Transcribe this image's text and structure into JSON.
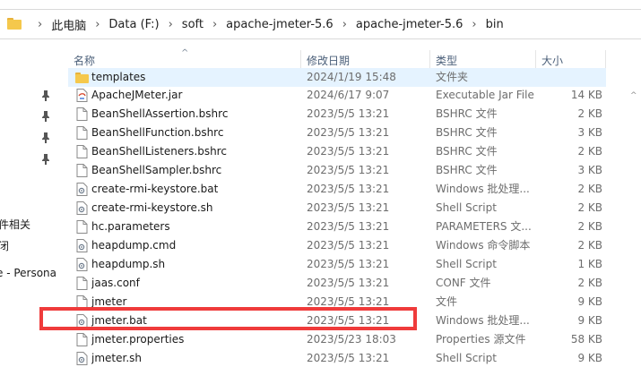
{
  "breadcrumb": [
    "此电脑",
    "Data (F:)",
    "soft",
    "apache-jmeter-5.6",
    "apache-jmeter-5.6",
    "bin"
  ],
  "columns": {
    "name": "名称",
    "modified": "修改日期",
    "type": "类型",
    "size": "大小"
  },
  "nav_labels": [
    "件相关",
    "闭",
    "e - Persona"
  ],
  "files": [
    {
      "name": "templates",
      "modified": "2024/1/19 15:48",
      "type": "文件夹",
      "size": "",
      "icon": "folder-icon"
    },
    {
      "name": "ApacheJMeter.jar",
      "modified": "2024/6/17 9:07",
      "type": "Executable Jar File",
      "size": "14 KB",
      "icon": "jar-file-icon"
    },
    {
      "name": "BeanShellAssertion.bshrc",
      "modified": "2023/5/5 13:21",
      "type": "BSHRC 文件",
      "size": "2 KB",
      "icon": "file-icon"
    },
    {
      "name": "BeanShellFunction.bshrc",
      "modified": "2023/5/5 13:21",
      "type": "BSHRC 文件",
      "size": "3 KB",
      "icon": "file-icon"
    },
    {
      "name": "BeanShellListeners.bshrc",
      "modified": "2023/5/5 13:21",
      "type": "BSHRC 文件",
      "size": "2 KB",
      "icon": "file-icon"
    },
    {
      "name": "BeanShellSampler.bshrc",
      "modified": "2023/5/5 13:21",
      "type": "BSHRC 文件",
      "size": "3 KB",
      "icon": "file-icon"
    },
    {
      "name": "create-rmi-keystore.bat",
      "modified": "2023/5/5 13:21",
      "type": "Windows 批处理...",
      "size": "2 KB",
      "icon": "script-file-icon"
    },
    {
      "name": "create-rmi-keystore.sh",
      "modified": "2023/5/5 13:21",
      "type": "Shell Script",
      "size": "2 KB",
      "icon": "script-file-icon"
    },
    {
      "name": "hc.parameters",
      "modified": "2023/5/5 13:21",
      "type": "PARAMETERS 文...",
      "size": "2 KB",
      "icon": "file-icon"
    },
    {
      "name": "heapdump.cmd",
      "modified": "2023/5/5 13:21",
      "type": "Windows 命令脚本",
      "size": "2 KB",
      "icon": "script-file-icon"
    },
    {
      "name": "heapdump.sh",
      "modified": "2023/5/5 13:21",
      "type": "Shell Script",
      "size": "1 KB",
      "icon": "script-file-icon"
    },
    {
      "name": "jaas.conf",
      "modified": "2023/5/5 13:21",
      "type": "CONF 文件",
      "size": "2 KB",
      "icon": "file-icon"
    },
    {
      "name": "jmeter",
      "modified": "2023/5/5 13:21",
      "type": "文件",
      "size": "9 KB",
      "icon": "file-icon"
    },
    {
      "name": "jmeter.bat",
      "modified": "2023/5/5 13:21",
      "type": "Windows 批处理...",
      "size": "9 KB",
      "icon": "script-file-icon"
    },
    {
      "name": "jmeter.properties",
      "modified": "2023/5/23 18:03",
      "type": "Properties 源文件",
      "size": "58 KB",
      "icon": "file-icon"
    },
    {
      "name": "jmeter.sh",
      "modified": "2023/5/5 13:21",
      "type": "Shell Script",
      "size": "9 KB",
      "icon": "script-file-icon"
    }
  ],
  "colors": {
    "accent_highlight": "#ef3b3b",
    "row_hover": "#e5f3ff",
    "folder": "#f5c84c"
  }
}
